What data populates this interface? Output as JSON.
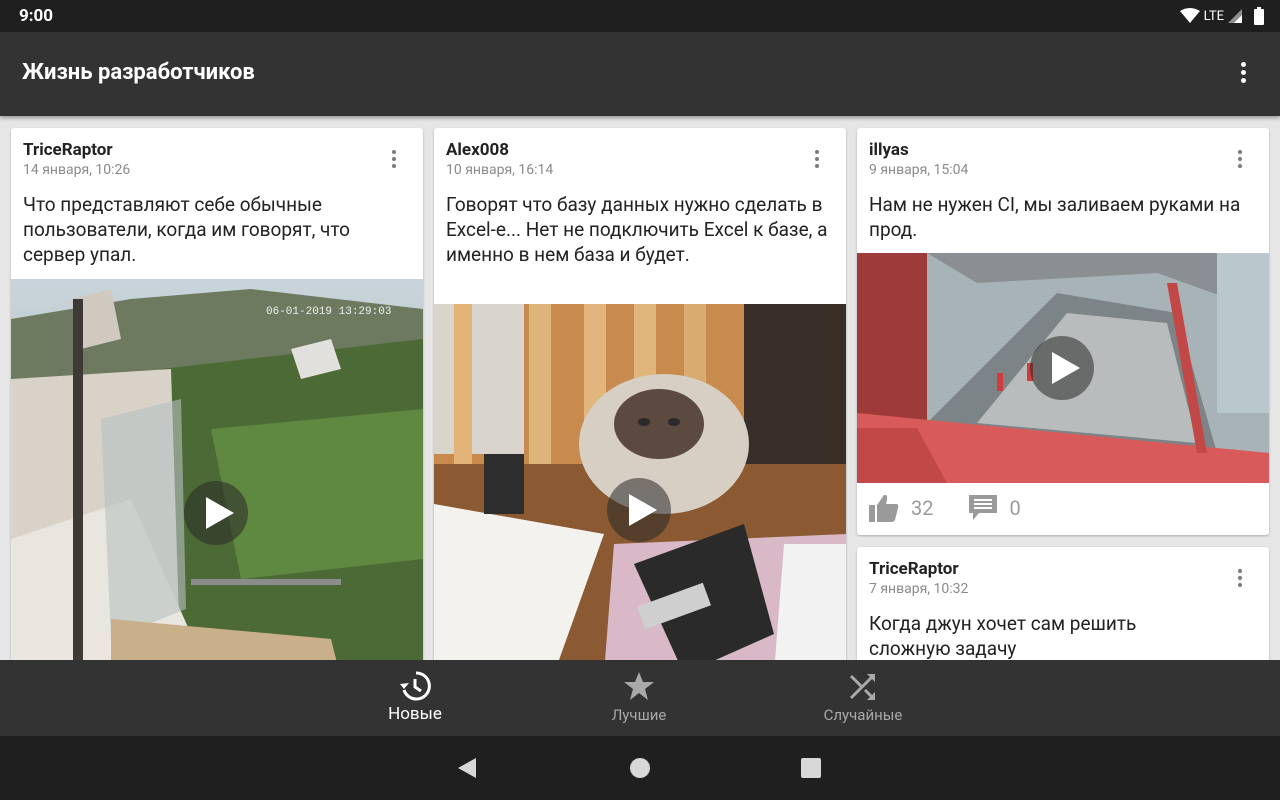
{
  "status_bar": {
    "time": "9:00",
    "network": "LTE"
  },
  "app_bar": {
    "title": "Жизнь разработчиков",
    "menu_icon": "more-vert-icon"
  },
  "posts": [
    {
      "author": "TriceRaptor",
      "date": "14 января, 10:26",
      "text": "Что представляют себе обычные пользователи, когда им говорят, что сервер упал.",
      "media_overlay": "06-01-2019 13:29:03"
    },
    {
      "author": "Alex008",
      "date": "10 января, 16:14",
      "text": "Говорят что базу данных нужно сделать в Excel-е... Нет не подключить Excel к базе, а именно в нем база и будет."
    },
    {
      "author": "illyas",
      "date": "9 января, 15:04",
      "text": "Нам не нужен CI, мы заливаем руками на прод.",
      "likes": "32",
      "comments": "0"
    },
    {
      "author": "TriceRaptor",
      "date": "7 января, 10:32",
      "text": "Когда джун хочет сам решить сложную задачу"
    }
  ],
  "bottom_nav": [
    {
      "label": "Новые",
      "icon": "history-icon",
      "active": true
    },
    {
      "label": "Лучшие",
      "icon": "star-icon",
      "active": false
    },
    {
      "label": "Случайные",
      "icon": "shuffle-icon",
      "active": false
    }
  ],
  "colors": {
    "appbar": "#333333",
    "statusbar": "#1f1f1f",
    "background": "#e6e6e6"
  }
}
